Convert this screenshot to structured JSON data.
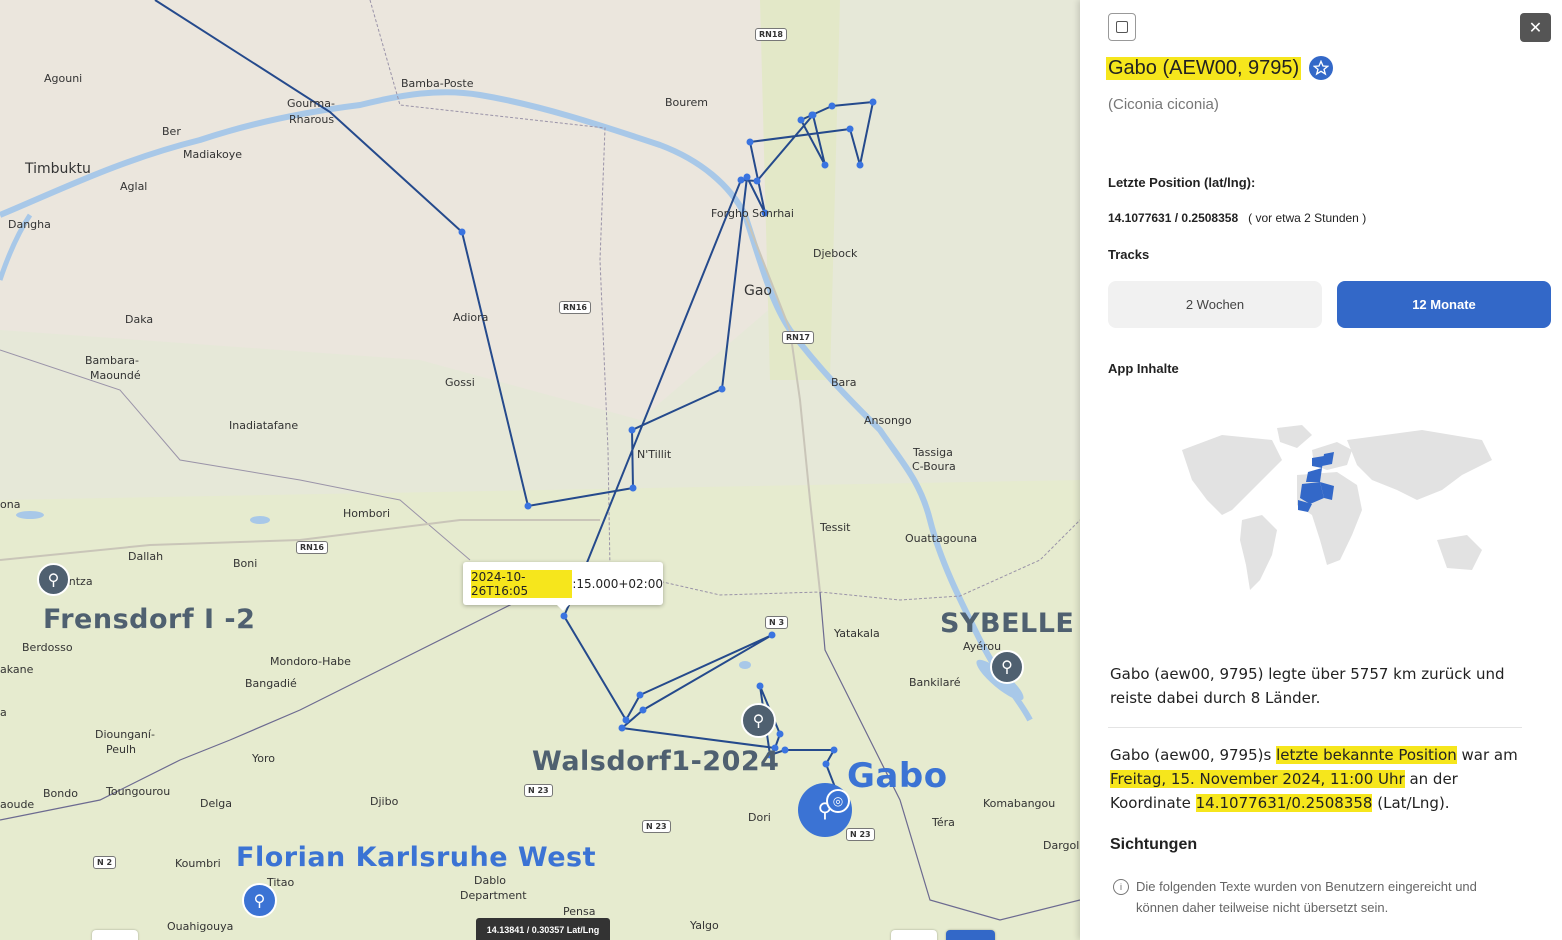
{
  "map": {
    "places": [
      "Agouni",
      "Gourma-",
      "Rharous",
      "Bamba-Poste",
      "Bourem",
      "Ber",
      "Madiakoye",
      "Timbuktu",
      "Aglal",
      "Dangha",
      "Forgho Sonrhai",
      "Djebock",
      "Gao",
      "Adiora",
      "Daka",
      "Bambara-",
      "Maoundé",
      "Gossi",
      "Bara",
      "Ansongo",
      "Inadiatafane",
      "N'Tillit",
      "Tassiga",
      "C-Boura",
      "Hombori",
      "Tessit",
      "Ouattagouna",
      "Dallah",
      "Boni",
      "entza",
      "ona",
      "Berdosso",
      "Mondoro-Habe",
      "Bangadié",
      "Yatakala",
      "Ayérou",
      "Bankilaré",
      "akane",
      "Diounganí-",
      "Peulh",
      "Yoro",
      "Bondo",
      "Toungourou",
      "Delga",
      "Djibo",
      "Dori",
      "Komabangou",
      "Téra",
      "aoude",
      "Koumbri",
      "Titao",
      "Dablo",
      "Department",
      "Dargol",
      "Ouahigouya",
      "Pensa",
      "Yalgo",
      "a"
    ],
    "roads": [
      "RN18",
      "RN16",
      "RN17",
      "RN16",
      "N 3",
      "N 23",
      "N 23",
      "N 2",
      "N 23"
    ],
    "birds": [
      {
        "name": "Frensdorf I -2",
        "color": "#4f6070"
      },
      {
        "name": "SYBELLE",
        "color": "#4f6070"
      },
      {
        "name": "Walsdorf1-2024",
        "color": "#4f6070"
      },
      {
        "name": "Gabo",
        "color": "#3b73d4"
      },
      {
        "name": "Florian Karlsruhe West",
        "color": "#3b73d4"
      }
    ],
    "tooltip": {
      "highlight": "2024-10-26T16:05",
      "rest": ":15.000+02:00"
    },
    "coords_readout": "14.13841 / 0.30357 Lat/Lng",
    "track_color": "#254a8c",
    "point_color": "#3a74e0"
  },
  "panel": {
    "title": "Gabo (AEW00, 9795)",
    "latin": "(Ciconia ciconia)",
    "last_position_label": "Letzte Position (lat/lng):",
    "last_position_value": "14.1077631 / 0.2508358",
    "last_position_ago": "( vor etwa 2 Stunden )",
    "tracks_label": "Tracks",
    "track_buttons": [
      "2 Wochen",
      "12 Monate"
    ],
    "app_content_label": "App Inhalte",
    "summary": "Gabo (aew00, 9795) legte über 5757 km zurück und reiste dabei durch 8 Länder.",
    "pos_text": {
      "p1": "Gabo (aew00, 9795)s ",
      "h1": "letzte bekannte Position",
      "p2": " war am ",
      "h2": "Freitag, 15. November 2024, 11:00 Uhr",
      "p3": " an der Koordinate ",
      "h3": "14.1077631/0.2508358",
      "p4": " (Lat/Lng)."
    },
    "sightings_label": "Sichtungen",
    "sightings_note": "Die folgenden Texte wurden von Benutzern eingereicht und können daher teilweise nicht übersetzt sein.",
    "accent": "#3368c8",
    "highlight": "#f6e61c"
  }
}
